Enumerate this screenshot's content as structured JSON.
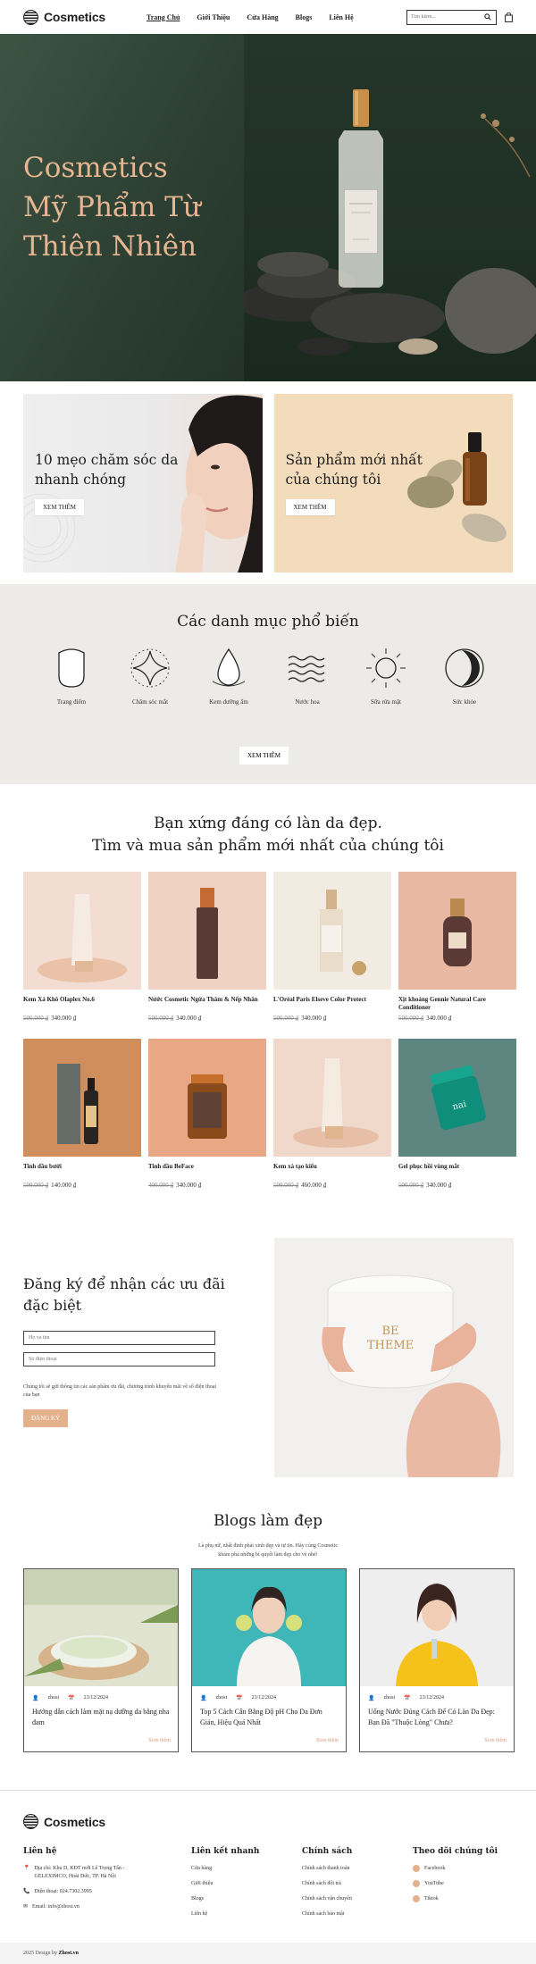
{
  "header": {
    "logo": "Cosmetics",
    "nav": [
      "Trang Chủ",
      "Giới Thiệu",
      "Cửa Hàng",
      "Blogs",
      "Liên Hệ"
    ],
    "search_placeholder": "Tìm kiếm..."
  },
  "hero": {
    "line1": "Cosmetics",
    "line2": "Mỹ Phẩm Từ",
    "line3": "Thiên Nhiên"
  },
  "promos": [
    {
      "title": "10 mẹo chăm sóc da nhanh chóng",
      "button": "XEM THÊM"
    },
    {
      "title": "Sản phẩm mới nhất của chúng tôi",
      "button": "XEM THÊM"
    }
  ],
  "categories": {
    "title": "Các danh mục phổ biến",
    "items": [
      "Trang điểm",
      "Chăm sóc mắt",
      "Kem dưỡng ẩm",
      "Nước hoa",
      "Sữa rửa mặt",
      "Sức khỏe"
    ],
    "button": "XEM THÊM"
  },
  "products": {
    "line1": "Bạn xứng đáng có làn da đẹp.",
    "line2": "Tìm và mua sản phẩm mới nhất của chúng tôi",
    "items": [
      {
        "name": "Kem Xả Khô Olaplex No.6",
        "old": "500.000 ₫",
        "new": "340.000 ₫"
      },
      {
        "name": "Nước Cosmetic Ngừa Thâm & Nếp Nhăn",
        "old": "500.000 ₫",
        "new": "340.000 ₫"
      },
      {
        "name": "L'Oréal Paris Elseve Color Protect",
        "old": "500.000 ₫",
        "new": "340.000 ₫"
      },
      {
        "name": "Xịt khoáng Gennie Natural Care Conditioner",
        "old": "500.000 ₫",
        "new": "340.000 ₫"
      },
      {
        "name": "Tinh dầu bưởi",
        "old": "500.000 ₫",
        "new": "140.000 ₫"
      },
      {
        "name": "Tinh dầu BeFace",
        "old": "400.000 ₫",
        "new": "340.000 ₫"
      },
      {
        "name": "Kem xả tạo kiểu",
        "old": "500.000 ₫",
        "new": "460.000 ₫"
      },
      {
        "name": "Gel phục hồi vùng mắt",
        "old": "500.000 ₫",
        "new": "340.000 ₫"
      }
    ]
  },
  "subscribe": {
    "title": "Đăng ký để nhận các ưu đãi đặc biệt",
    "name_placeholder": "Họ và tên",
    "phone_placeholder": "Số điện thoại",
    "note": "Chúng tôi sẽ gửi thông tin các sản phẩm ưu đãi, chương trình khuyến mãi về số điện thoại của bạn",
    "button": "ĐĂNG KÝ",
    "jar_text1": "BE",
    "jar_text2": "THEME"
  },
  "blogs": {
    "title": "Blogs làm đẹp",
    "lede1": "Là phụ nữ, nhất định phải xinh đẹp và tự tin. Hãy cùng Cosmetic",
    "lede2": "khám phá những bí quyết làm đẹp cho vẻ nhé!",
    "items": [
      {
        "author": "zhost",
        "date": "23/12/2024",
        "title": "Hướng dẫn cách làm mặt nạ dưỡng da bằng nha đam",
        "more": "Xem thêm"
      },
      {
        "author": "zhost",
        "date": "23/12/2024",
        "title": "Top 5 Cách Cân Bằng Độ pH Cho Da Đơn Giản, Hiệu Quả Nhất",
        "more": "Xem thêm"
      },
      {
        "author": "zhost",
        "date": "23/12/2024",
        "title": "Uống Nước Đúng Cách Để Có Làn Da Đẹp: Bạn Đã \"Thuộc Lòng\" Chưa?",
        "more": "Xem thêm"
      }
    ]
  },
  "footer": {
    "logo": "Cosmetics",
    "contact": {
      "title": "Liên hệ",
      "address": "Địa chỉ: Khu D, KĐT mới Lê Trọng Tấn - GELEXIMCO, Hoài Đức, TP. Hà Nội",
      "phone": "Điện thoại: 024.7302.3995",
      "email": "Email: info@zhost.vn"
    },
    "links": {
      "title": "Liên kết nhanh",
      "items": [
        "Cửa hàng",
        "Giới thiệu",
        "Blogs",
        "Liên hệ"
      ]
    },
    "policy": {
      "title": "Chính sách",
      "items": [
        "Chính sách thanh toán",
        "Chính sách đổi trả",
        "Chính sách vận chuyển",
        "Chính sách bảo mật"
      ]
    },
    "follow": {
      "title": "Theo dõi chúng tôi",
      "items": [
        "Facebook",
        "YouTube",
        "Tiktok"
      ]
    },
    "copyright": "2025 Design by",
    "copyright_brand": "Zhost.vn"
  }
}
